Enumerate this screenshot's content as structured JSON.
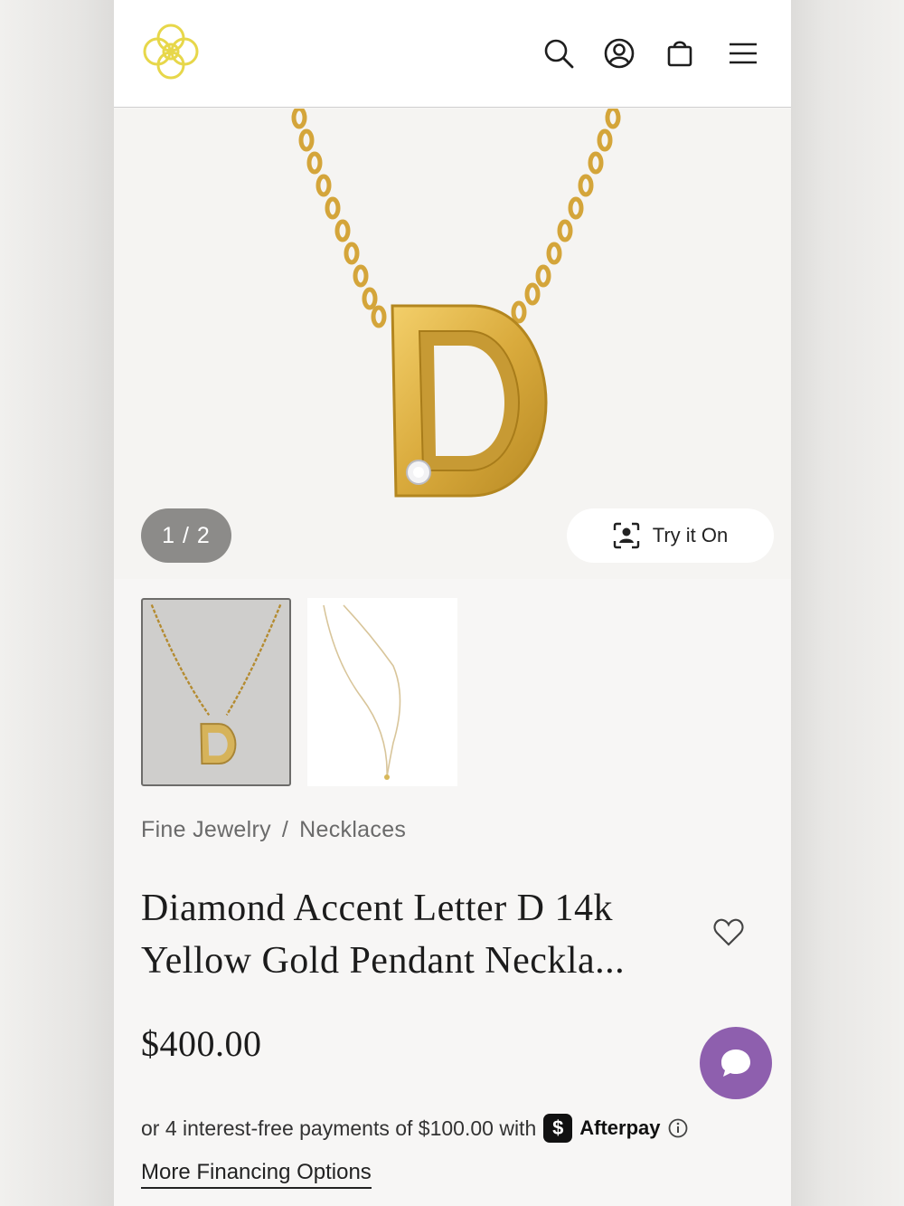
{
  "header": {
    "logo_icon": "kendra-scott-logo-icon",
    "search_icon": "search-icon",
    "account_icon": "account-icon",
    "bag_icon": "bag-icon",
    "menu_icon": "menu-icon"
  },
  "gallery": {
    "pager": "1 / 2",
    "try_on_label": "Try it On",
    "try_on_icon": "face-scan-icon",
    "thumbnails": [
      "necklace-front-thumbnail",
      "necklace-full-thumbnail"
    ]
  },
  "product": {
    "breadcrumb": [
      "Fine Jewelry",
      "/",
      "Necklaces"
    ],
    "title": "Diamond Accent Letter D 14k Yellow Gold Pendant Neckla...",
    "price": "$400.00"
  },
  "payment": {
    "afterpay_text": "or 4 interest-free payments of $100.00 with",
    "afterpay_badge": "$",
    "afterpay_name": "Afterpay",
    "more_financing": "More Financing Options"
  },
  "colors": {
    "logo": "#e7d74a",
    "chat": "#8e5fae",
    "gold": "#d9aa3c"
  }
}
